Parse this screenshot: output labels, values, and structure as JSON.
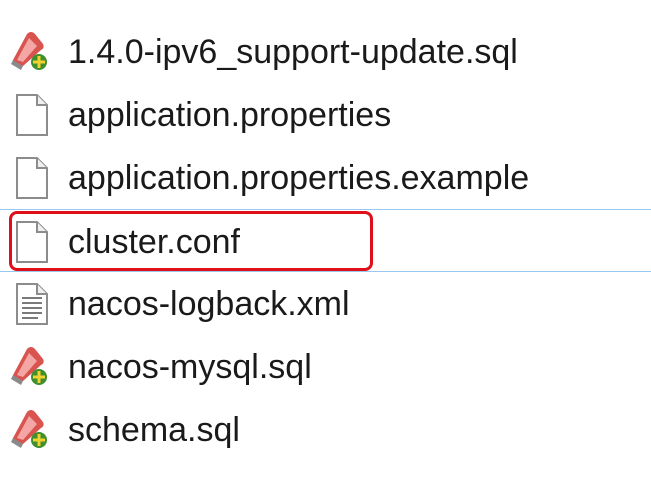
{
  "files": [
    {
      "name": "1.4.0-ipv6_support-update.sql",
      "icon": "sql-file-icon"
    },
    {
      "name": "application.properties",
      "icon": "blank-file-icon"
    },
    {
      "name": "application.properties.example",
      "icon": "blank-file-icon"
    },
    {
      "name": "cluster.conf",
      "icon": "blank-file-icon",
      "selected": true,
      "highlighted": true
    },
    {
      "name": "nacos-logback.xml",
      "icon": "text-file-icon"
    },
    {
      "name": "nacos-mysql.sql",
      "icon": "sql-file-icon"
    },
    {
      "name": "schema.sql",
      "icon": "sql-file-icon"
    }
  ],
  "colors": {
    "highlight_border": "#e0101a",
    "selection_line": "#99c9ef",
    "text": "#1a1a1a"
  }
}
